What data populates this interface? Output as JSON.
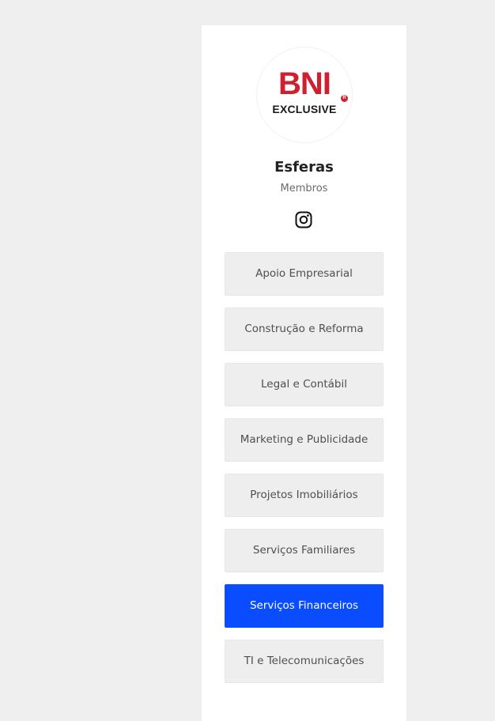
{
  "logo": {
    "brand": "BNI",
    "tagline": "EXCLUSIVE",
    "registered_mark": "R",
    "brand_color": "#cf2030"
  },
  "profile": {
    "title": "Esferas",
    "subtitle": "Membros",
    "social_icon": "instagram-icon"
  },
  "links": [
    {
      "label": "Apoio Empresarial",
      "active": false
    },
    {
      "label": "Construção e Reforma",
      "active": false
    },
    {
      "label": "Legal e Contábil",
      "active": false
    },
    {
      "label": "Marketing e Publicidade",
      "active": false
    },
    {
      "label": "Projetos Imobiliários",
      "active": false
    },
    {
      "label": "Serviços Familiares",
      "active": false
    },
    {
      "label": "Serviços Financeiros",
      "active": true
    },
    {
      "label": "TI e Telecomunicações",
      "active": false
    }
  ],
  "colors": {
    "page_background": "#efefef",
    "card_background": "#ffffff",
    "button_background": "#eeeeee",
    "active_button": "#0a4cff"
  }
}
